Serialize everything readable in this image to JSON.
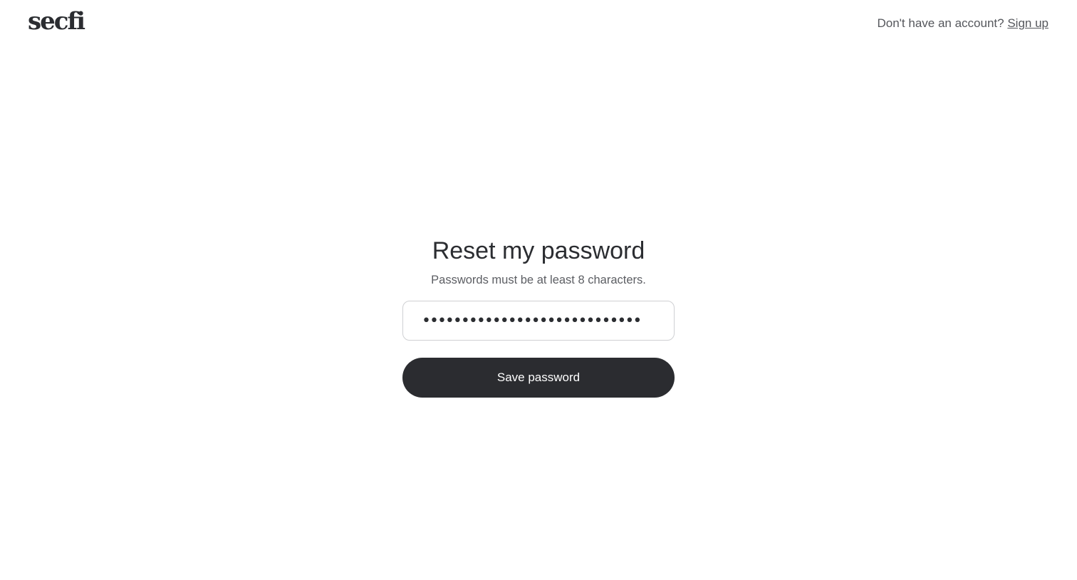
{
  "header": {
    "logo_text": "secfi",
    "account_prompt": "Don't have an account?",
    "signup_link": "Sign up"
  },
  "form": {
    "title": "Reset my password",
    "subtitle": "Passwords must be at least 8 characters.",
    "password_value": "••••••••••••••••••••••••••••",
    "save_label": "Save password"
  },
  "colors": {
    "button_bg": "#2b2c30",
    "text_primary": "#2b2d31",
    "text_secondary": "#5c5e63",
    "border": "#cfd0d3"
  }
}
